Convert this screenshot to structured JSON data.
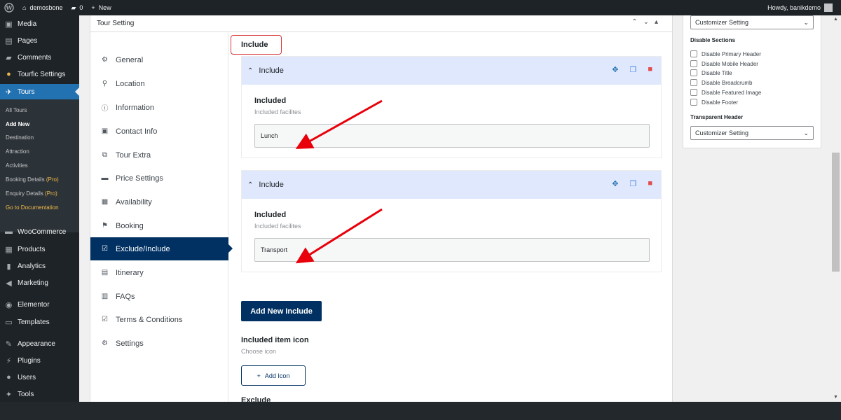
{
  "admin_bar": {
    "site_name": "demosbone",
    "comments_count": "0",
    "new_label": "New",
    "howdy": "Howdy, banikdemo"
  },
  "menu": {
    "media": "Media",
    "pages": "Pages",
    "comments": "Comments",
    "tourfic": "Tourfic Settings",
    "tours": "Tours",
    "woocommerce": "WooCommerce",
    "products": "Products",
    "analytics": "Analytics",
    "marketing": "Marketing",
    "elementor": "Elementor",
    "templates": "Templates",
    "appearance": "Appearance",
    "plugins": "Plugins",
    "users": "Users",
    "tools": "Tools"
  },
  "submenu": {
    "all_tours": "All Tours",
    "add_new": "Add New",
    "destination": "Destination",
    "attraction": "Attraction",
    "activities": "Activities",
    "booking_details": "Booking Details",
    "enquiry_details": "Enquiry Details",
    "pro": "(Pro)",
    "docs": "Go to Documentation"
  },
  "box": {
    "title": "Tour Setting"
  },
  "tabs": {
    "general": "General",
    "location": "Location",
    "information": "Information",
    "contact": "Contact Info",
    "extra": "Tour Extra",
    "price": "Price Settings",
    "availability": "Availability",
    "booking": "Booking",
    "exclude_include": "Exclude/Include",
    "itinerary": "Itinerary",
    "faqs": "FAQs",
    "terms": "Terms & Conditions",
    "settings": "Settings"
  },
  "pane": {
    "heading": "Include",
    "items": [
      {
        "header": "Include",
        "label": "Included",
        "sublabel": "Included facilites",
        "value": "Lunch"
      },
      {
        "header": "Include",
        "label": "Included",
        "sublabel": "Included facilites",
        "value": "Transport"
      }
    ],
    "add_new": "Add New Include",
    "icon_label": "Included item icon",
    "icon_sub": "Choose icon",
    "add_icon": "Add Icon",
    "exclude_label": "Exclude"
  },
  "right_panel": {
    "select1": "Customizer Setting",
    "disable_sections": "Disable Sections",
    "checkboxes": [
      "Disable Primary Header",
      "Disable Mobile Header",
      "Disable Title",
      "Disable Breadcrumb",
      "Disable Featured Image",
      "Disable Footer"
    ],
    "transparent_header": "Transparent Header",
    "select2": "Customizer Setting"
  },
  "colors": {
    "accent": "#003162",
    "wp_blue": "#2271b1",
    "arrow": "#e8000b"
  }
}
